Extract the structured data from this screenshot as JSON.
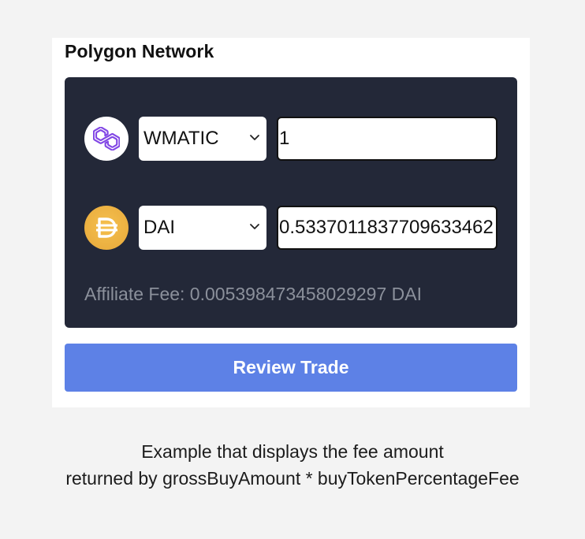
{
  "network": {
    "title": "Polygon Network"
  },
  "sell": {
    "icon": "polygon-matic-icon",
    "token": "WMATIC",
    "amount": "1"
  },
  "buy": {
    "icon": "dai-icon",
    "token": "DAI",
    "amount": "0.5337011837709633462"
  },
  "fee_text": "Affiliate Fee: 0.005398473458029297 DAI",
  "review_button_label": "Review Trade",
  "caption": {
    "line1": "Example that displays the fee amount",
    "line2": "returned by grossBuyAmount * buyTokenPercentageFee"
  },
  "colors": {
    "panel": "#232838",
    "button": "#5d81e6",
    "matic": "#8247e5",
    "dai": "#f2b743"
  }
}
